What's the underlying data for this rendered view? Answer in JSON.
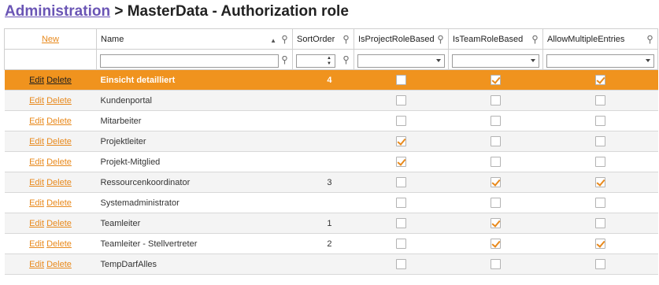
{
  "header": {
    "breadcrumb_link": "Administration",
    "separator": ">",
    "page_title": "MasterData - Authorization role"
  },
  "table": {
    "new_label": "New",
    "columns": [
      "Name",
      "SortOrder",
      "IsProjectRoleBased",
      "IsTeamRoleBased",
      "AllowMultipleEntries"
    ],
    "filters": {
      "name": "",
      "sortorder": "",
      "project": "",
      "team": "",
      "multiple": ""
    },
    "edit_label": "Edit",
    "delete_label": "Delete",
    "selected_row": 0,
    "rows": [
      {
        "name": "Einsicht detailliert",
        "sort": "4",
        "project": false,
        "team": true,
        "multiple": true
      },
      {
        "name": "Kundenportal",
        "sort": "",
        "project": false,
        "team": false,
        "multiple": false
      },
      {
        "name": "Mitarbeiter",
        "sort": "",
        "project": false,
        "team": false,
        "multiple": false
      },
      {
        "name": "Projektleiter",
        "sort": "",
        "project": true,
        "team": false,
        "multiple": false
      },
      {
        "name": "Projekt-Mitglied",
        "sort": "",
        "project": true,
        "team": false,
        "multiple": false
      },
      {
        "name": "Ressourcenkoordinator",
        "sort": "3",
        "project": false,
        "team": true,
        "multiple": true
      },
      {
        "name": "Systemadministrator",
        "sort": "",
        "project": false,
        "team": false,
        "multiple": false
      },
      {
        "name": "Teamleiter",
        "sort": "1",
        "project": false,
        "team": true,
        "multiple": false
      },
      {
        "name": "Teamleiter - Stellvertreter",
        "sort": "2",
        "project": false,
        "team": true,
        "multiple": true
      },
      {
        "name": "TempDarfAlles",
        "sort": "",
        "project": false,
        "team": false,
        "multiple": false
      }
    ]
  },
  "colors": {
    "accent": "#f0931e",
    "link": "#e8891c",
    "breadcrumb": "#6a55b5"
  }
}
